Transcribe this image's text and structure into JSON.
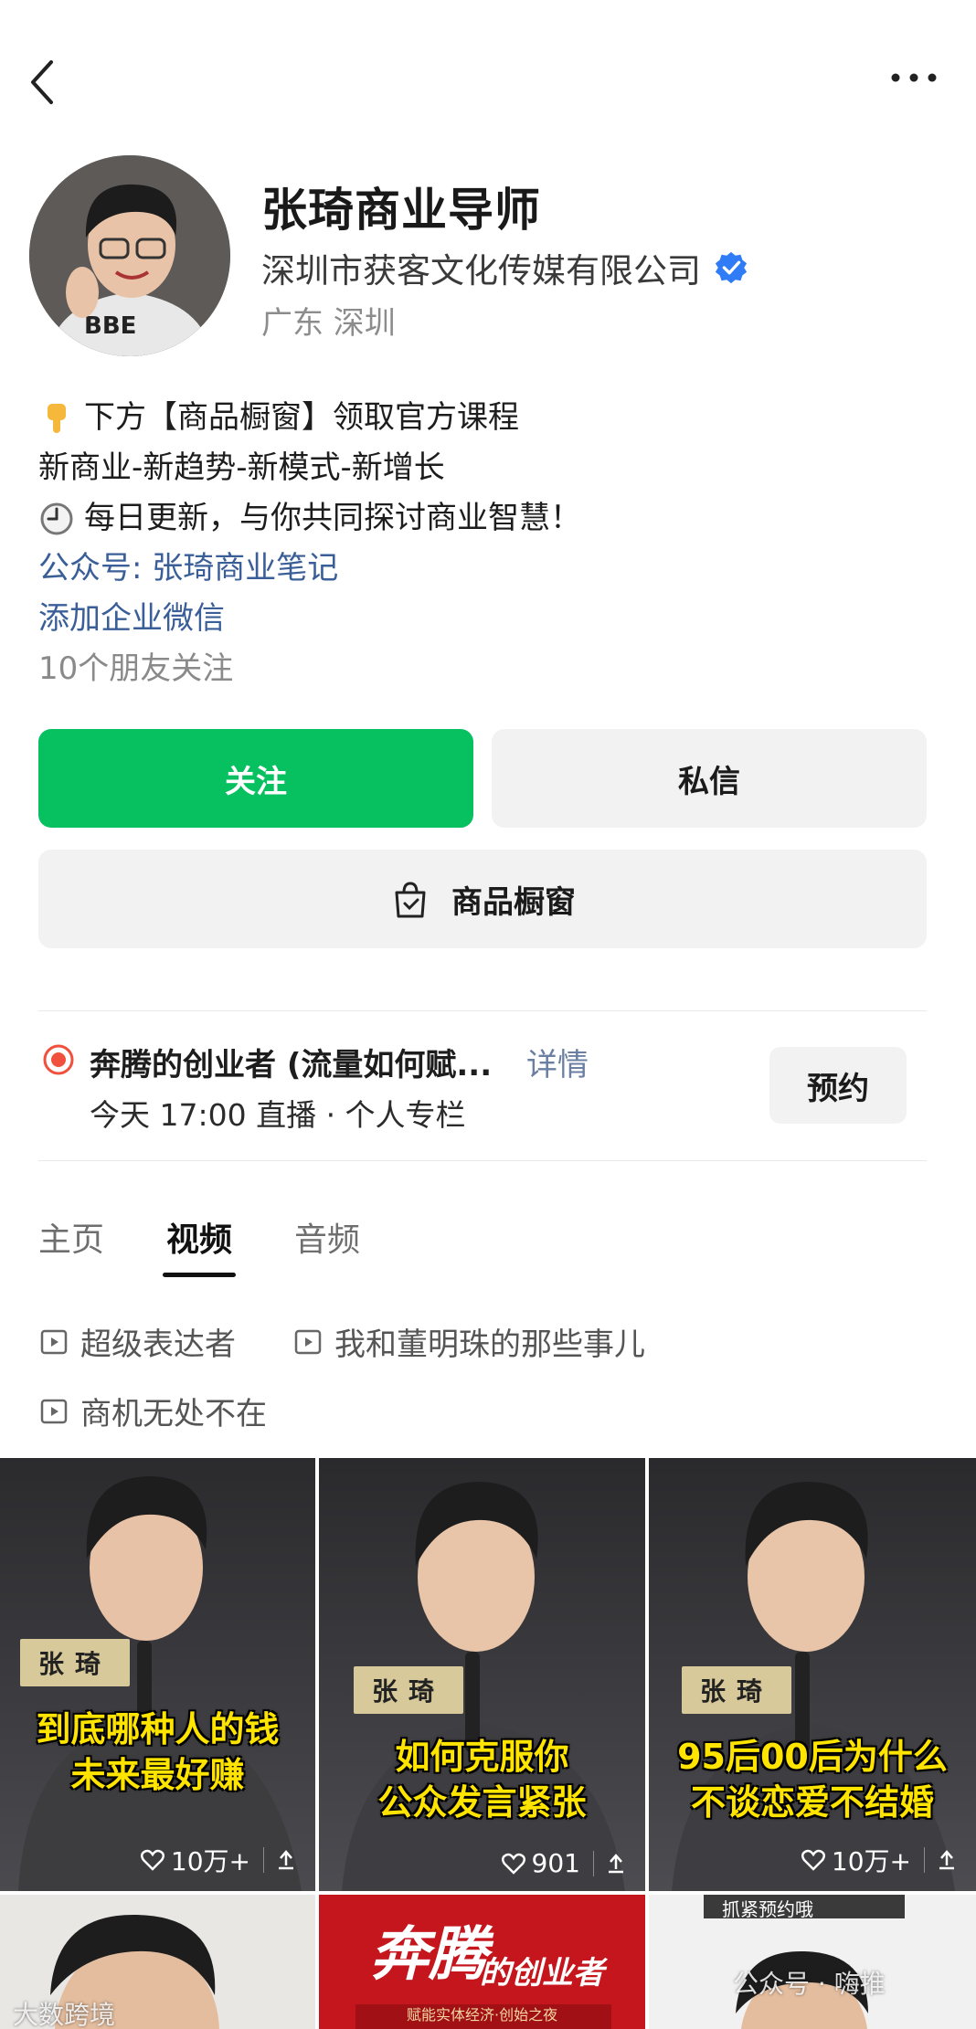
{
  "profile": {
    "name": "张琦商业导师",
    "company": "深圳市获客文化传媒有限公司",
    "location": "广东 深圳"
  },
  "bio": {
    "line1": "下方【商品橱窗】领取官方课程",
    "line2": "新商业-新趋势-新模式-新增长",
    "line3": "每日更新，与你共同探讨商业智慧！",
    "official_account": "公众号: 张琦商业笔记",
    "wecom": "添加企业微信",
    "friends_following": "10个朋友关注"
  },
  "buttons": {
    "follow": "关注",
    "message": "私信",
    "shop": "商品橱窗"
  },
  "live": {
    "title": "奔腾的创业者 (流量如何赋...",
    "detail": "详情",
    "subtitle": "今天 17:00 直播 · 个人专栏",
    "reserve": "预约"
  },
  "tabs": [
    {
      "label": "主页",
      "active": false
    },
    {
      "label": "视频",
      "active": true
    },
    {
      "label": "音频",
      "active": false
    }
  ],
  "collections": [
    "超级表达者",
    "我和董明珠的那些事儿",
    "商机无处不在"
  ],
  "videos": [
    {
      "tag": "张琦",
      "caption_line1": "到底哪种人的钱",
      "caption_line2": "未来最好赚",
      "likes": "10万+"
    },
    {
      "tag": "张琦",
      "caption_line1": "如何克服你",
      "caption_line2": "公众发言紧张",
      "likes": "901"
    },
    {
      "tag": "张琦",
      "caption_line1": "95后00后为什么",
      "caption_line2": "不谈恋爱不结婚",
      "likes": "10万+"
    }
  ],
  "second_row": {
    "poster_title": "奔腾",
    "poster_title2": "的创业者",
    "poster_sub": "赋能实体经济·创始之夜",
    "banner_text": "抓紧预约哦"
  },
  "watermarks": {
    "left": "大数跨境",
    "right": "公众号 · 嗨推"
  },
  "colors": {
    "accent_green": "#07c160",
    "link_blue": "#3a5e98",
    "verified_blue": "#2f7cf6",
    "live_red": "#f1503c",
    "caption_yellow": "#ffe400"
  }
}
